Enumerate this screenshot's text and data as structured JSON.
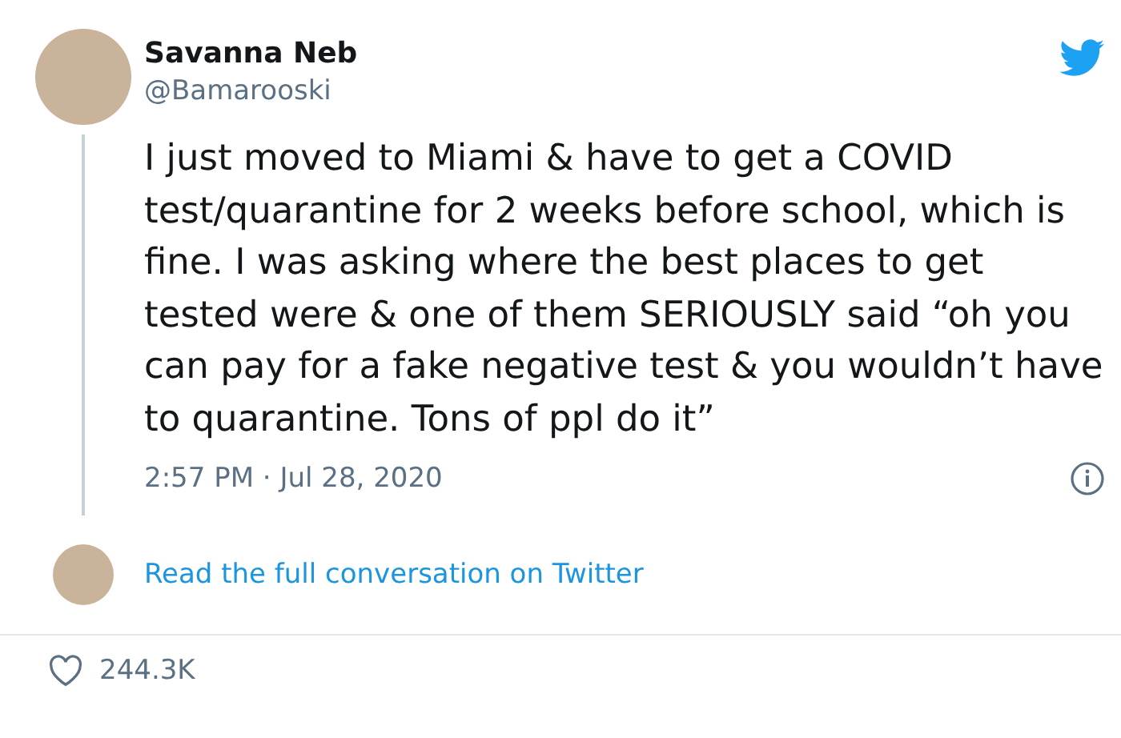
{
  "author": {
    "name": "Savanna Neb",
    "handle": "@Bamarooski"
  },
  "tweet": {
    "text": "I just moved to Miami & have to get a COVID test/quarantine for 2 weeks before school, which is fine. I was asking where the best places to get tested were & one of them SERIOUSLY said “oh you can pay for a fake negative test & you wouldn’t have to quarantine. Tons of ppl do it”",
    "timestamp": "2:57 PM · Jul 28, 2020"
  },
  "conversation_link": "Read the full conversation on Twitter",
  "likes": "244.3K"
}
